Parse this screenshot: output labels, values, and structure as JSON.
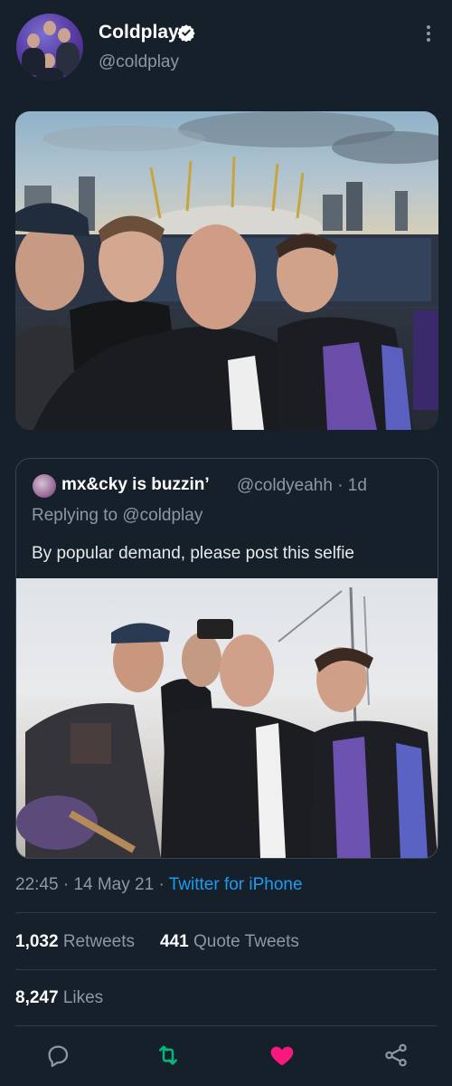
{
  "header": {
    "display_name": "Coldplay",
    "handle": "@coldplay",
    "verified_icon": "verified-badge-icon",
    "more_icon": "more-vertical-icon"
  },
  "quoted_tweet": {
    "display_name": "mx&cky is buzzin’",
    "handle_time": "@coldyeahh · 1d",
    "replying_prefix": "Replying to ",
    "replying_handle": "@coldplay",
    "text": "By popular demand, please post this selfie"
  },
  "meta": {
    "time": "22:45",
    "sep1": " · ",
    "date": "14 May 21",
    "sep2": " · ",
    "source": "Twitter for iPhone"
  },
  "stats": {
    "retweets_count": "1,032",
    "retweets_label": "Retweets",
    "quotes_count": "441",
    "quotes_label": "Quote Tweets",
    "likes_count": "8,247",
    "likes_label": "Likes"
  },
  "actions": [
    {
      "icon": "reply-icon"
    },
    {
      "icon": "retweet-icon"
    },
    {
      "icon": "like-icon"
    },
    {
      "icon": "share-icon"
    }
  ],
  "colors": {
    "background": "#15202b",
    "accent": "#1d9bf0",
    "retweet": "#00ba7c",
    "like": "#f91880"
  }
}
